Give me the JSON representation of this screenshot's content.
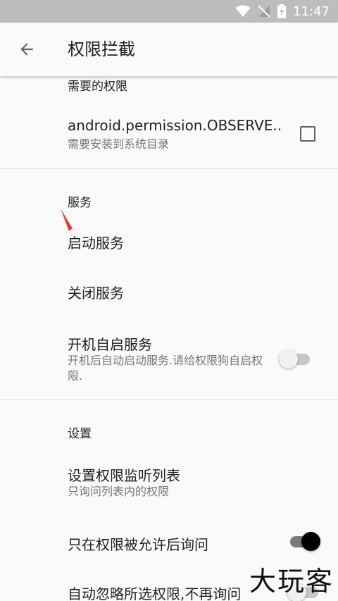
{
  "status": {
    "time": "11:47",
    "icons": [
      "wifi-icon",
      "no-signal-icon",
      "battery-charging-icon"
    ]
  },
  "toolbar": {
    "back_icon": "arrow-back-icon",
    "title": "权限拦截"
  },
  "sections": {
    "permissions": {
      "header": "需要的权限",
      "item_title": "android.permission.OBSERVE..",
      "item_summary": "需要安装到系统目录",
      "checked": false
    },
    "service": {
      "header": "服务",
      "start": "启动服务",
      "stop": "关闭服务",
      "autostart_title": "开机自启服务",
      "autostart_summary": "开机后自动启动服务.请给权限狗自启权限.",
      "autostart_on": false
    },
    "settings": {
      "header": "设置",
      "monitor_title": "设置权限监听列表",
      "monitor_summary": "只询问列表内的权限",
      "ask_after_granted": "只在权限被允许后询问",
      "ask_after_granted_on": true,
      "auto_ignore": "自动忽略所选权限,不再询问",
      "auto_ignore_on": false
    }
  },
  "watermark": "大玩客",
  "colors": {
    "status_bar": "#bdbdbd",
    "background": "#fafafa",
    "annotation_arrow": "#e53935"
  }
}
